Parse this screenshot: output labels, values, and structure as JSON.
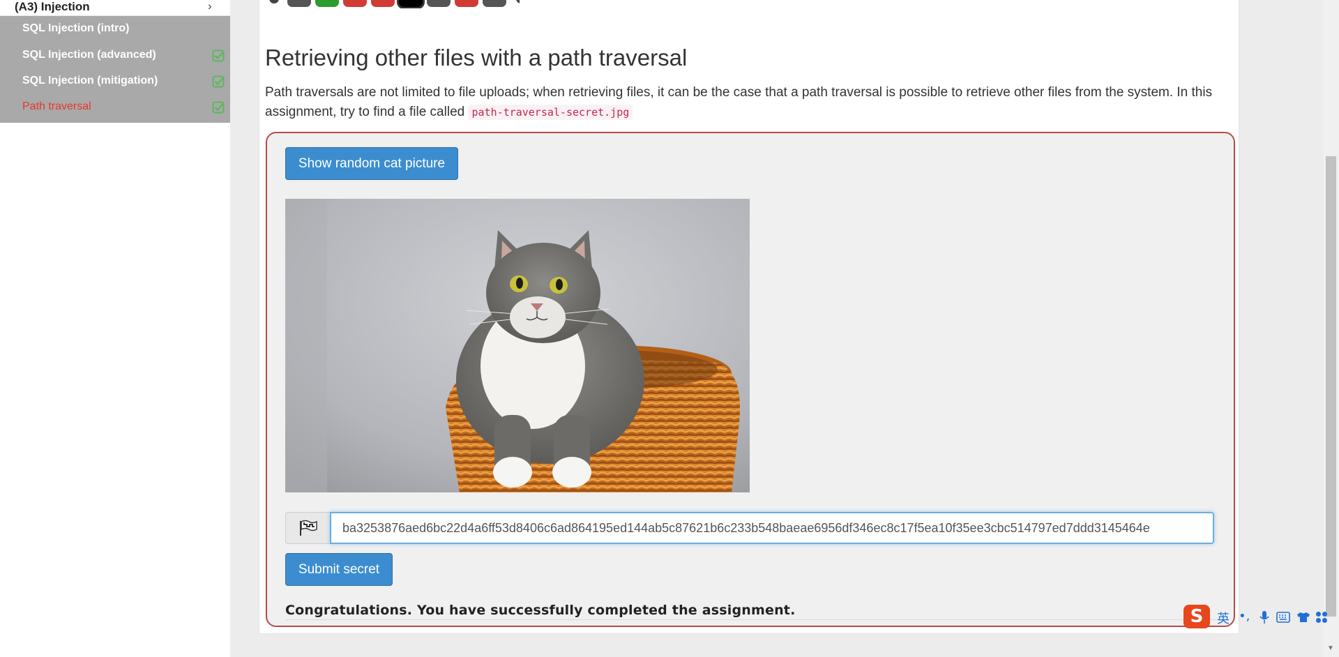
{
  "sidebar": {
    "group_title": "(A3) Injection",
    "chevron": "›",
    "lessons": [
      {
        "label": "SQL Injection (intro)",
        "completed": false,
        "active": false
      },
      {
        "label": "SQL Injection (advanced)",
        "completed": true,
        "active": false
      },
      {
        "label": "SQL Injection (mitigation)",
        "completed": true,
        "active": false
      },
      {
        "label": "Path traversal",
        "completed": true,
        "active": true
      }
    ]
  },
  "progress_dots": {
    "colors": [
      "#555555",
      "#2e9b2e",
      "#d23b35",
      "#d23b35",
      "#000000",
      "#555555",
      "#d23b35",
      "#555555"
    ]
  },
  "lesson": {
    "title": "Retrieving other files with a path traversal",
    "description_before": "Path traversals are not limited to file uploads; when retrieving files, it can be the case that a path traversal is possible to retrieve other files from the system. In this assignment, try to find a file called ",
    "description_code": "path-traversal-secret.jpg"
  },
  "assignment": {
    "show_cat_button": "Show random cat picture",
    "flag_icon": "flag-icon",
    "secret_value": "ba3253876aed6bc22d4a6ff53d8406c6ad864195ed144ab5c87621b6c233b548baeae6956df346ec8c17f5ea10f35ee3cbc514797ed7ddd3145464e",
    "submit_button": "Submit secret",
    "feedback": "Congratulations. You have successfully completed the assignment."
  },
  "ime": {
    "logo": "S",
    "lang": "英",
    "punct": "•,",
    "icons": [
      "microphone-icon",
      "keyboard-icon",
      "shirt-icon",
      "grid-icon"
    ]
  },
  "colors": {
    "accent": "#3c8dcf",
    "success": "#5cb85c",
    "active_lesson": "#e8372c",
    "assignment_border": "#b94a48"
  }
}
